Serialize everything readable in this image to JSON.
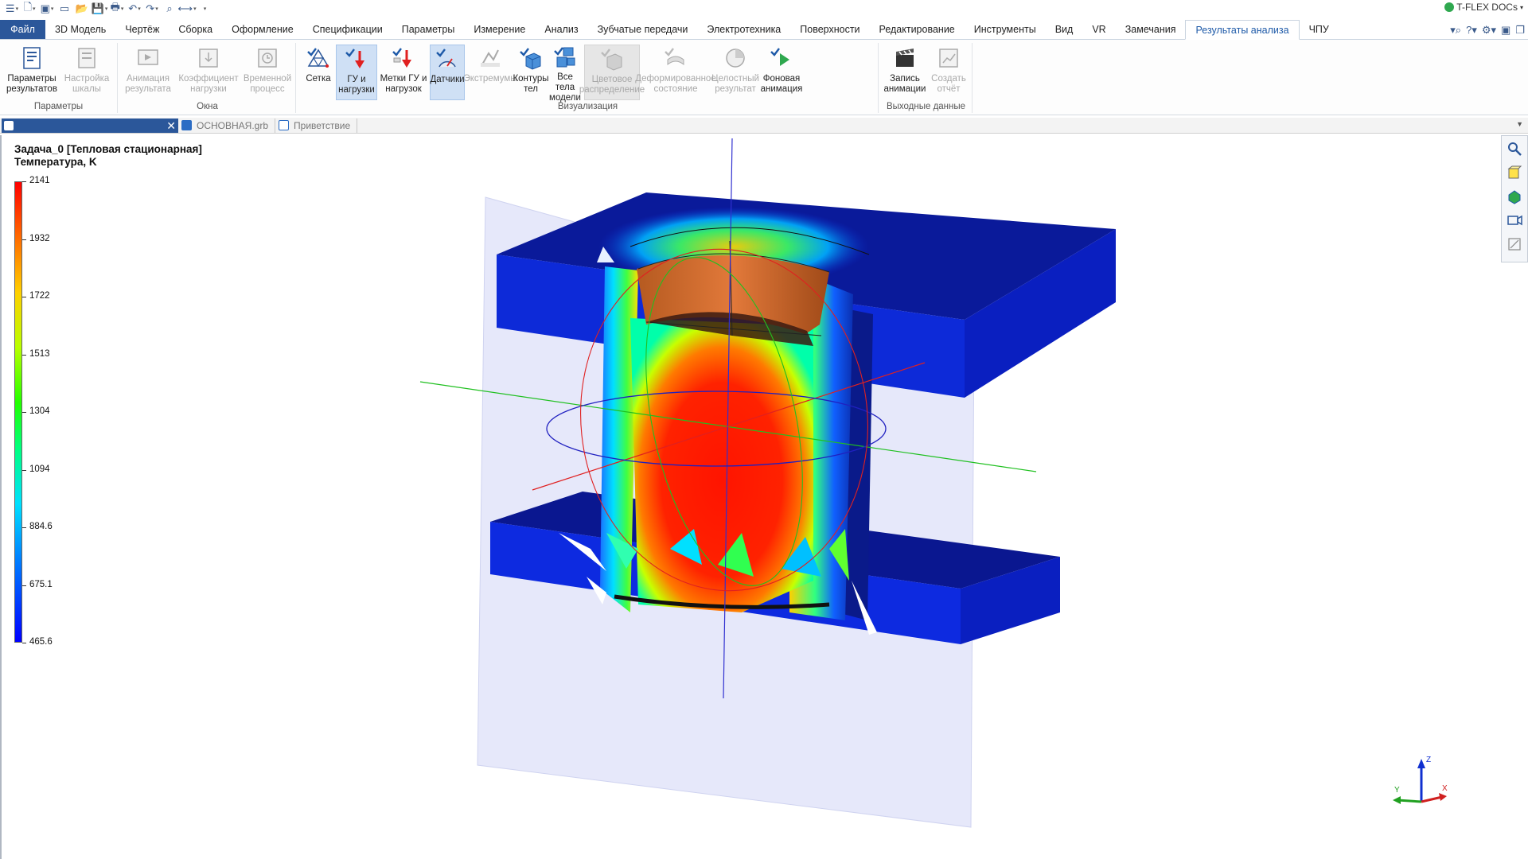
{
  "qat": {
    "icons": [
      "menu-icon",
      "new-doc-icon",
      "open-3d-icon",
      "window-icon",
      "open-folder-icon",
      "save-icon",
      "print-icon",
      "undo-icon",
      "redo-icon",
      "zoom-icon",
      "measure-icon",
      "customize-icon"
    ]
  },
  "app": {
    "docs_label": "T-FLEX DOCs"
  },
  "tabs": [
    {
      "label": "Файл"
    },
    {
      "label": "3D Модель"
    },
    {
      "label": "Чертёж"
    },
    {
      "label": "Сборка"
    },
    {
      "label": "Оформление"
    },
    {
      "label": "Спецификации"
    },
    {
      "label": "Параметры"
    },
    {
      "label": "Измерение"
    },
    {
      "label": "Анализ"
    },
    {
      "label": "Зубчатые передачи"
    },
    {
      "label": "Электротехника"
    },
    {
      "label": "Поверхности"
    },
    {
      "label": "Редактирование"
    },
    {
      "label": "Инструменты"
    },
    {
      "label": "Вид"
    },
    {
      "label": "VR"
    },
    {
      "label": "Замечания"
    },
    {
      "label": "Результаты анализа"
    },
    {
      "label": "ЧПУ"
    }
  ],
  "ribbon": {
    "groups": [
      {
        "label": "Параметры"
      },
      {
        "label": "Окна"
      },
      {
        "label": "Визуализация"
      },
      {
        "label": "Выходные данные"
      }
    ],
    "buttons": {
      "result_params": [
        "Параметры",
        "результатов"
      ],
      "scale_settings": [
        "Настройка",
        "шкалы"
      ],
      "result_animation": [
        "Анимация",
        "результата"
      ],
      "load_factor": [
        "Коэффициент",
        "нагрузки"
      ],
      "time_process": [
        "Временной",
        "процесс"
      ],
      "mesh": [
        "Сетка",
        ""
      ],
      "bc_loads": [
        "ГУ и",
        "нагрузки"
      ],
      "bc_marks": [
        "Метки ГУ и",
        "нагрузок"
      ],
      "sensors": [
        "Датчики",
        ""
      ],
      "extremums": [
        "Экстремумы",
        ""
      ],
      "body_contours": [
        "Контуры",
        "тел"
      ],
      "all_bodies": [
        "Все тела",
        "модели"
      ],
      "color_distribution": [
        "Цветовое",
        "распределение"
      ],
      "deformed_state": [
        "Деформированное",
        "состояние"
      ],
      "integral_result": [
        "Целостный",
        "результат"
      ],
      "background_animation": [
        "Фоновая",
        "анимация"
      ],
      "record_animation": [
        "Запись",
        "анимации"
      ],
      "create_report": [
        "Создать",
        "отчёт"
      ]
    }
  },
  "doctabs": {
    "tab2": "ОСНОВНАЯ.grb",
    "tab3": "Приветствие"
  },
  "viewport": {
    "title_line1": "Задача_0 [Тепловая стационарная]",
    "title_line2": "Температура, K",
    "legend": [
      "2141",
      "1932",
      "1722",
      "1513",
      "1304",
      "1094",
      "884.6",
      "675.1",
      "465.6"
    ],
    "triad": {
      "x": "X",
      "y": "Y",
      "z": "Z"
    }
  },
  "colors": {
    "accent": "#2b579a",
    "active_tab_text": "#1e5aa8",
    "hot": "#ff1a00",
    "cold": "#0a1fd6"
  }
}
